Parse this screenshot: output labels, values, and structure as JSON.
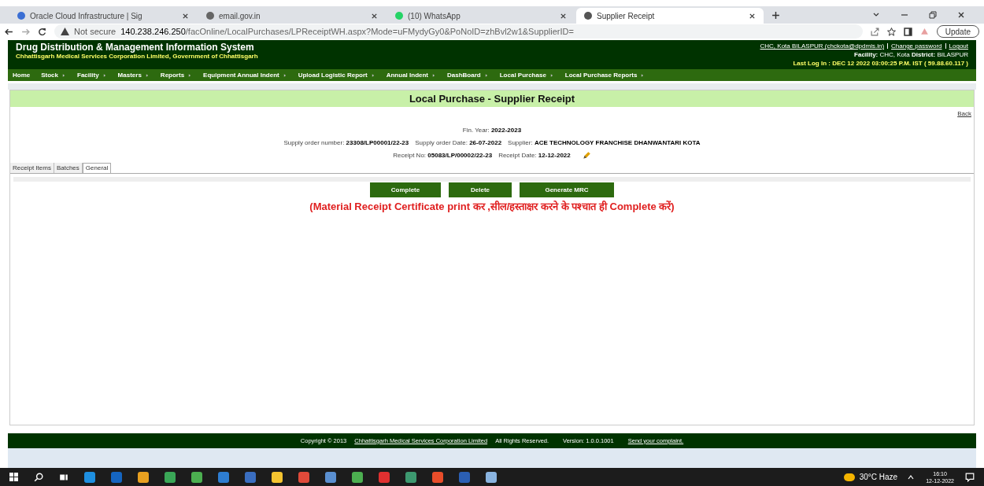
{
  "browser": {
    "tabs": [
      {
        "title": "Oracle Cloud Infrastructure | Sig",
        "selected": false,
        "color": "#3b6fd4"
      },
      {
        "title": "email.gov.in",
        "selected": false,
        "color": "#666666"
      },
      {
        "title": "(10) WhatsApp",
        "selected": false,
        "color": "#25d366"
      },
      {
        "title": "Supplier Receipt",
        "selected": true,
        "color": "#555555"
      }
    ],
    "security": "Not secure",
    "url_host": "140.238.246.250",
    "url_path": "/facOnline/LocalPurchases/LPReceiptWH.aspx?Mode=uFMydyGy0&PoNoID=zhBvl2w1&SupplierID=",
    "update_button": "Update"
  },
  "header": {
    "title": "Drug Distribution & Management Information System",
    "subtitle": "Chhattisgarh Medical Services Corporation Limited, Government of Chhattisgarh",
    "user_link": "CHC, Kota BILASPUR (chckota@dpdmis.in)",
    "change_password": "Change password",
    "logout": "Logout",
    "facility_label": "Facility:",
    "facility": "CHC, Kota",
    "district_label": "District:",
    "district": "BILASPUR",
    "last_login": "Last Log In : DEC 12 2022 03:00:25 P.M. IST ( 59.88.60.117 )"
  },
  "menu": [
    {
      "label": "Home",
      "submenu": false
    },
    {
      "label": "Stock",
      "submenu": true
    },
    {
      "label": "Facility",
      "submenu": true
    },
    {
      "label": "Masters",
      "submenu": true
    },
    {
      "label": "Reports",
      "submenu": true
    },
    {
      "label": "Equipment Annual Indent",
      "submenu": true
    },
    {
      "label": "Upload Logistic Report",
      "submenu": true
    },
    {
      "label": "Annual Indent",
      "submenu": true
    },
    {
      "label": "DashBoard",
      "submenu": true
    },
    {
      "label": "Local Purchase",
      "submenu": true
    },
    {
      "label": "Local Purchase Reports",
      "submenu": true
    }
  ],
  "page_title": "Local Purchase - Supplier Receipt",
  "back_link": "Back",
  "info": {
    "fin_year_label": "Fin. Year:",
    "fin_year": "2022-2023",
    "fields": [
      {
        "label": "Supply order number:",
        "value": "23308/LP00001/22-23"
      },
      {
        "label": "Supply order Date:",
        "value": "26-07-2022"
      },
      {
        "label": "Supplier:",
        "value": "ACE TECHNOLOGY FRANCHISE DHANWANTARI KOTA"
      }
    ],
    "receipt": [
      {
        "label": "Receipt No:",
        "value": "05083/LP/00002/22-23"
      },
      {
        "label": "Receipt Date:",
        "value": "12-12-2022"
      }
    ]
  },
  "tabs": [
    {
      "label": "Receipt Items",
      "selected": false
    },
    {
      "label": "Batches",
      "selected": false
    },
    {
      "label": "General",
      "selected": true
    }
  ],
  "buttons": [
    "Complete",
    "Delete",
    "Generate MRC"
  ],
  "note": "(Material Receipt Certificate print कर ,सील/हस्ताक्षर करने के पश्चात ही Complete करें)",
  "footer": {
    "copyright": "Copyright  ©  2013",
    "company_link": "Chhattisgarh Medical Services Corporation Limited",
    "rights": "All Rights Reserved.",
    "version": "Version:  1.0.0.1001",
    "complaint_link": "Send your complaint."
  },
  "taskbar": {
    "temperature": "30°C",
    "weather": "Haze",
    "time": "16:10",
    "date": "12-12-2022"
  }
}
